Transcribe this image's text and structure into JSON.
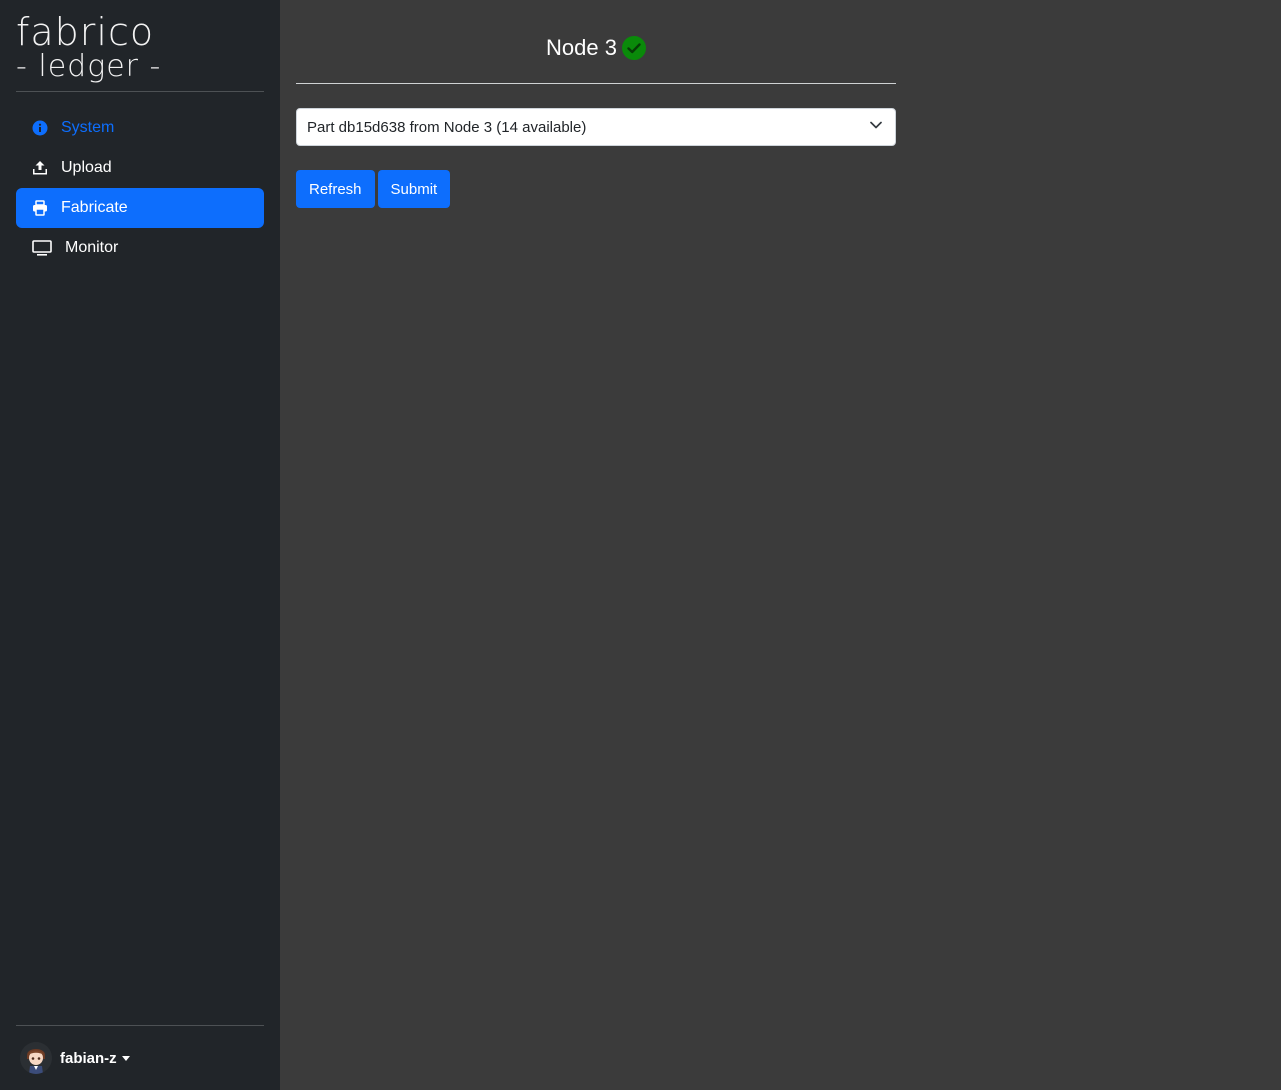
{
  "brand": {
    "line1": "fabrico",
    "line2": "- ledger -"
  },
  "sidebar": {
    "items": [
      {
        "label": "System",
        "icon": "info-circle-icon"
      },
      {
        "label": "Upload",
        "icon": "upload-icon"
      },
      {
        "label": "Fabricate",
        "icon": "printer-icon"
      },
      {
        "label": "Monitor",
        "icon": "monitor-icon"
      }
    ],
    "active": "Fabricate"
  },
  "user": {
    "name": "fabian-z"
  },
  "main": {
    "node_title": "Node 3",
    "status_icon": "check-circle-icon",
    "status_color": "#0a8a0a",
    "part_select": {
      "selected": "Part db15d638 from Node 3 (14 available)"
    },
    "buttons": {
      "refresh": "Refresh",
      "submit": "Submit"
    }
  },
  "colors": {
    "accent": "#0d6efd",
    "sidebar_bg": "#212529",
    "main_bg": "#3b3b3b"
  }
}
